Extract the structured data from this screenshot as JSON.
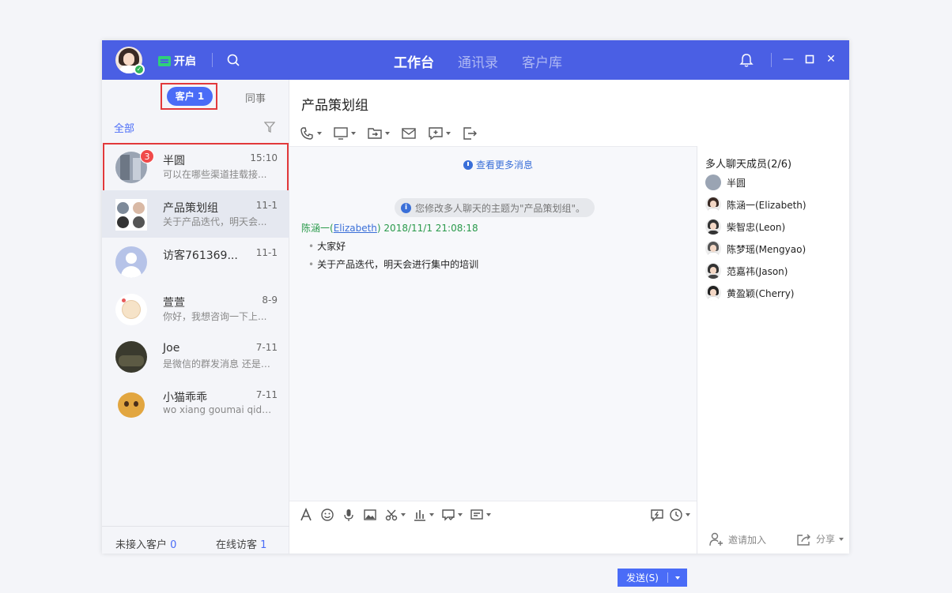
{
  "topbar": {
    "status_label": "开启",
    "nav": [
      {
        "label": "工作台",
        "active": true
      },
      {
        "label": "通讯录",
        "active": false
      },
      {
        "label": "客户库",
        "active": false
      }
    ],
    "icons": [
      "search-icon",
      "bell-icon",
      "minimize-icon",
      "maximize-icon",
      "close-icon"
    ]
  },
  "left": {
    "tab_customer": "客户 1",
    "tab_colleague": "同事",
    "filter_all": "全部",
    "conversations": [
      {
        "name": "半圆",
        "time": "15:10",
        "preview": "可以在哪些渠道挂载接...",
        "badge": "3"
      },
      {
        "name": "产品策划组",
        "time": "11-1",
        "preview": "关于产品迭代，明天会..."
      },
      {
        "name": "访客761369...",
        "time": "11-1",
        "preview": ""
      },
      {
        "name": "萱萱",
        "time": "8-9",
        "preview": "你好，我想咨询一下上..."
      },
      {
        "name": "Joe",
        "time": "7-11",
        "preview": "是微信的群发消息 还是 ..."
      },
      {
        "name": "小猫乖乖",
        "time": "7-11",
        "preview": "wo xiang goumai qidi..."
      }
    ],
    "footer": {
      "unassigned_label": "未接入客户",
      "unassigned_count": "0",
      "online_label": "在线访客",
      "online_count": "1"
    }
  },
  "chat": {
    "title": "产品策划组",
    "more_messages": "查看更多消息",
    "system_note": "您修改多人聊天的主题为\"产品策划组\"。",
    "sender_name": "陈涵一(",
    "sender_link": "Elizabeth",
    "sender_tail": ")",
    "timestamp": "2018/11/1 21:08:18",
    "lines": [
      "大家好",
      "关于产品迭代，明天会进行集中的培训"
    ],
    "send_label": "发送(S)"
  },
  "members": {
    "title": "多人聊天成员(2/6)",
    "list": [
      "半圆",
      "陈涵一(Elizabeth)",
      "柴智忠(Leon)",
      "陈梦瑶(Mengyao)",
      "范嘉祎(Jason)",
      "黄盈颖(Cherry)"
    ],
    "invite_label": "邀请加入",
    "share_label": "分享"
  },
  "colors": {
    "topbar": "#4a5fe4",
    "accent": "#4a6cf7",
    "highlight": "#e2393b",
    "sender": "#2a9a4b"
  }
}
